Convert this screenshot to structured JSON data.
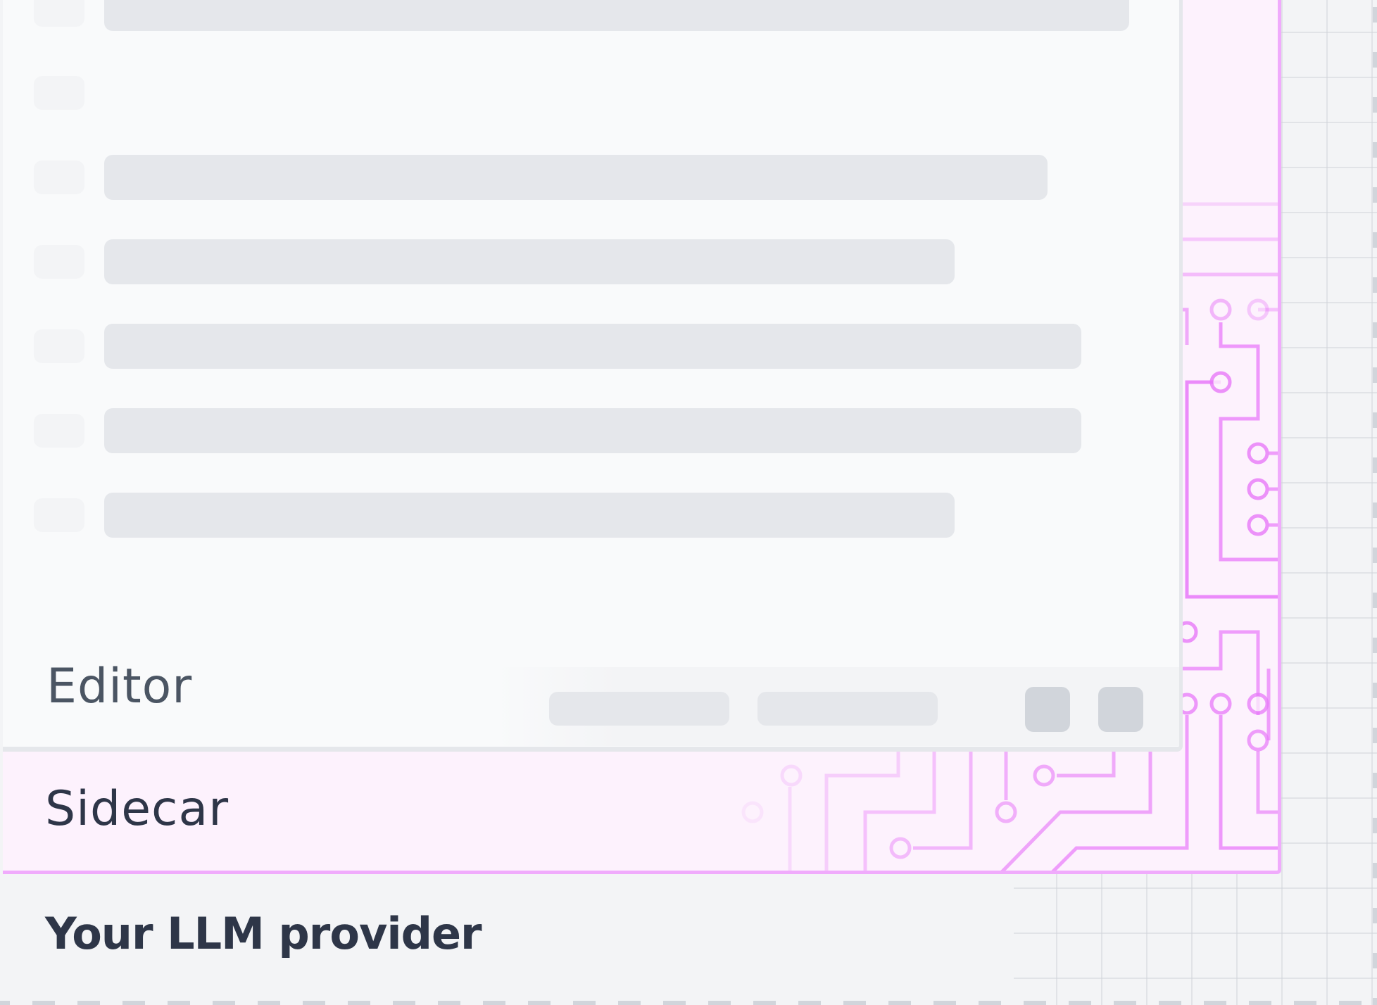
{
  "layers": {
    "editor": {
      "label": "Editor"
    },
    "sidecar": {
      "label": "Sidecar"
    },
    "provider": {
      "label": "Your LLM provider"
    }
  },
  "colors": {
    "background": "#f3f4f6",
    "sidecar_fill": "#fdf2fd",
    "sidecar_accent": "#f0abfc",
    "circuit_trace": "#e879f9",
    "editor_fill": "#f9fafb",
    "placeholder": "#e5e7eb",
    "text": "#2e3648"
  },
  "icons": [
    "circuit-pattern",
    "window-control-icon"
  ]
}
